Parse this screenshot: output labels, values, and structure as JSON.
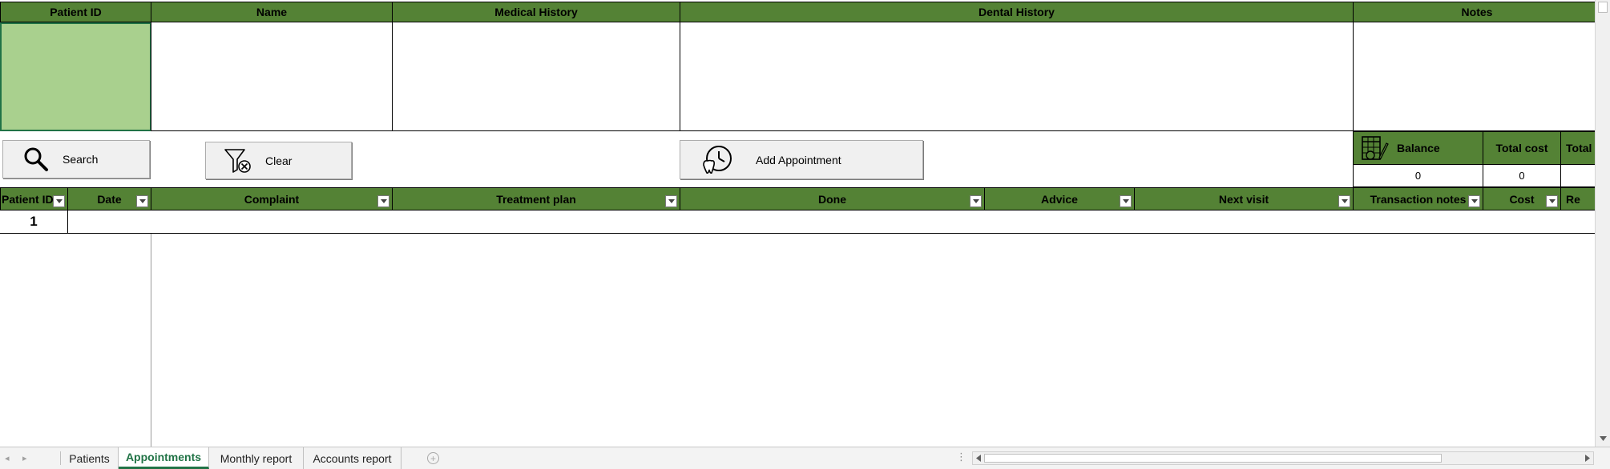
{
  "header_fields": {
    "patient_id": "Patient ID",
    "name": "Name",
    "medical_history": "Medical History",
    "dental_history": "Dental History",
    "notes": "Notes"
  },
  "buttons": {
    "search": "Search",
    "clear": "Clear",
    "add_appointment": "Add Appointment"
  },
  "summary": {
    "balance_label": "Balance",
    "total_cost_label": "Total cost",
    "total_label": "Total",
    "balance_value": "0",
    "total_cost_value": "0"
  },
  "table": {
    "columns": [
      "Patient ID",
      "Date",
      "Complaint",
      "Treatment plan",
      "Done",
      "Advice",
      "Next visit",
      "Transaction notes",
      "Cost",
      "Re"
    ],
    "rows": [
      [
        "1",
        "",
        "",
        "",
        "",
        "",
        "",
        "",
        "",
        ""
      ]
    ]
  },
  "sheet_tabs": [
    "Patients",
    "Appointments",
    "Monthly report",
    "Accounts report"
  ],
  "active_tab": "Appointments",
  "colors": {
    "header_green": "#548235",
    "selected_cell": "#a9d08e",
    "excel_green": "#217346"
  }
}
